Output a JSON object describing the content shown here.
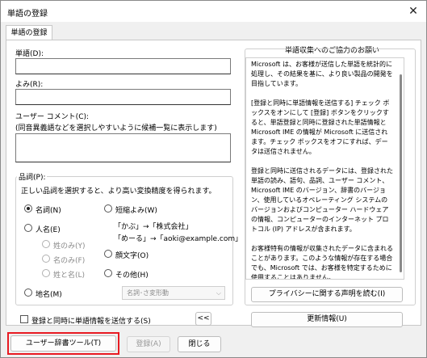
{
  "window": {
    "title": "単語の登録",
    "close_glyph": "✕"
  },
  "tab": {
    "label": "単語の登録"
  },
  "form": {
    "word_label": "単語(D):",
    "word_value": "",
    "reading_label": "よみ(R):",
    "reading_value": "",
    "comment_label": "ユーザー コメント(C):",
    "comment_hint": "(同音異義語などを選択しやすいように候補一覧に表示します)",
    "comment_value": ""
  },
  "pos": {
    "group_label": "品詞(P):",
    "description": "正しい品詞を選択すると、より高い変換精度を得られます。",
    "options": {
      "noun": "名詞(N)",
      "person": "人名(E)",
      "given_name": "姓のみ(Y)",
      "family_name": "名のみ(F)",
      "full_name": "姓と名(L)",
      "place": "地名(M)",
      "abbrev": "短縮よみ(W)",
      "face": "顔文字(O)",
      "other": "その他(H)"
    },
    "examples": {
      "line1": "「かぶ」→「株式会社」",
      "line2": "「めーる」→「aoki@example.com」"
    },
    "select_value": "名詞･さ変形動",
    "selected": "noun"
  },
  "bottom": {
    "send_checkbox_label": "登録と同時に単語情報を送信する(S)",
    "send_checked": false,
    "collapse_button": "<<"
  },
  "info": {
    "title": "単語収集へのご協力のお願い",
    "paragraphs": [
      "Microsoft は、お客様が送信した単語を統計的に処理し、その結果を基に、より良い製品の開発を目指しています。",
      "[登録と同時に単語情報を送信する] チェック ボックスをオンにして [登録] ボタンをクリックすると、単語登録と同時に登録された単語情報と Microsoft IME の情報が Microsoft に送信されます。チェック ボックスをオフにすれば、データは送信されません。",
      "登録と同時に送信されるデータには、登録された単語の読み、語句、品詞、ユーザー コメント、Microsoft IME のバージョン、辞書のバージョン、使用しているオペレーティング システムのバージョンおよびコンピューター ハードウェアの情報、コンピューターのインターネット プロトコル (IP) アドレスが含まれます。",
      "お客様特有の情報が収集されたデータに含まれることがあります。このような情報が存在する場合でも、Microsoft では、お客様を特定するために使用することはありません。"
    ],
    "privacy_button": "プライバシーに関する声明を読む(I)",
    "update_button": "更新情報(U)"
  },
  "footer": {
    "user_dict_button": "ユーザー辞書ツール(T)",
    "register_button": "登録(A)",
    "close_button": "閉じる"
  },
  "colors": {
    "highlight": "#e81a22",
    "window_bg": "#f0f0f0"
  }
}
